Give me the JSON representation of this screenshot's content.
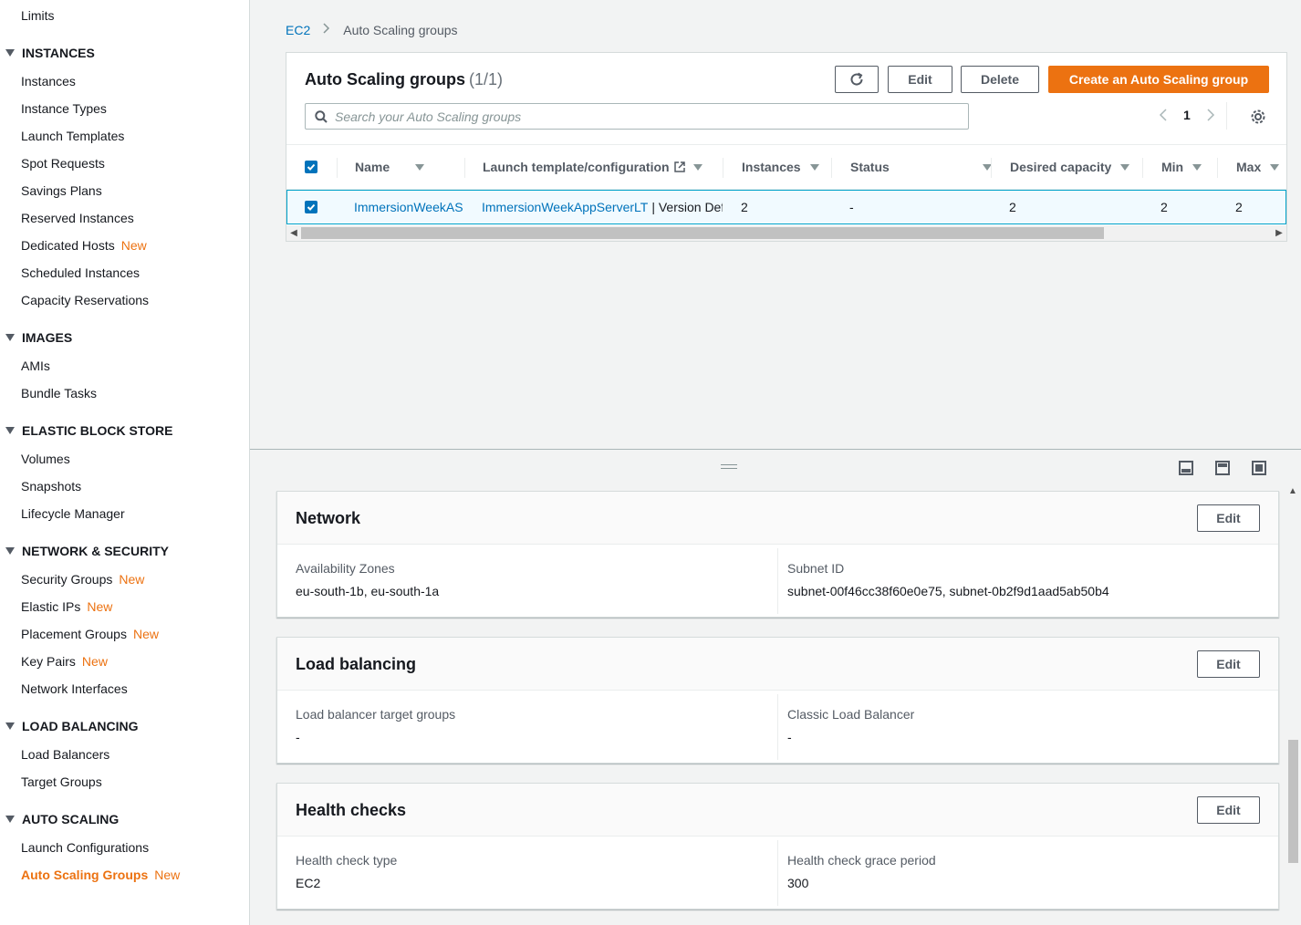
{
  "sidebar": {
    "top_link": "Limits",
    "sections": [
      {
        "title": "INSTANCES",
        "items": [
          {
            "label": "Instances"
          },
          {
            "label": "Instance Types"
          },
          {
            "label": "Launch Templates"
          },
          {
            "label": "Spot Requests"
          },
          {
            "label": "Savings Plans"
          },
          {
            "label": "Reserved Instances"
          },
          {
            "label": "Dedicated Hosts",
            "badge": "New"
          },
          {
            "label": "Scheduled Instances"
          },
          {
            "label": "Capacity Reservations"
          }
        ]
      },
      {
        "title": "IMAGES",
        "items": [
          {
            "label": "AMIs"
          },
          {
            "label": "Bundle Tasks"
          }
        ]
      },
      {
        "title": "ELASTIC BLOCK STORE",
        "items": [
          {
            "label": "Volumes"
          },
          {
            "label": "Snapshots"
          },
          {
            "label": "Lifecycle Manager"
          }
        ]
      },
      {
        "title": "NETWORK & SECURITY",
        "items": [
          {
            "label": "Security Groups",
            "badge": "New"
          },
          {
            "label": "Elastic IPs",
            "badge": "New"
          },
          {
            "label": "Placement Groups",
            "badge": "New"
          },
          {
            "label": "Key Pairs",
            "badge": "New"
          },
          {
            "label": "Network Interfaces"
          }
        ]
      },
      {
        "title": "LOAD BALANCING",
        "items": [
          {
            "label": "Load Balancers"
          },
          {
            "label": "Target Groups"
          }
        ]
      },
      {
        "title": "AUTO SCALING",
        "items": [
          {
            "label": "Launch Configurations"
          },
          {
            "label": "Auto Scaling Groups",
            "badge": "New",
            "active": true
          }
        ]
      }
    ]
  },
  "breadcrumb": {
    "root": "EC2",
    "separator": ">",
    "current": "Auto Scaling groups"
  },
  "asg_panel": {
    "title": "Auto Scaling groups",
    "count": "(1/1)",
    "buttons": {
      "edit": "Edit",
      "delete": "Delete",
      "create": "Create an Auto Scaling group"
    },
    "search_placeholder": "Search your Auto Scaling groups",
    "page": "1",
    "columns": {
      "name": "Name",
      "launch": "Launch template/configuration",
      "instances": "Instances",
      "status": "Status",
      "desired": "Desired capacity",
      "min": "Min",
      "max": "Max"
    },
    "row": {
      "name": "ImmersionWeekAS",
      "launch_link": "ImmersionWeekAppServerLT",
      "launch_suffix": "| Version Def",
      "instances": "2",
      "status": "-",
      "desired": "2",
      "min": "2",
      "max": "2"
    }
  },
  "cards": {
    "network": {
      "title": "Network",
      "edit": "Edit",
      "left_label": "Availability Zones",
      "left_value": "eu-south-1b, eu-south-1a",
      "right_label": "Subnet ID",
      "right_value": "subnet-00f46cc38f60e0e75, subnet-0b2f9d1aad5ab50b4"
    },
    "load_balancing": {
      "title": "Load balancing",
      "edit": "Edit",
      "left_label": "Load balancer target groups",
      "left_value": "-",
      "right_label": "Classic Load Balancer",
      "right_value": "-"
    },
    "health_checks": {
      "title": "Health checks",
      "edit": "Edit",
      "left_label": "Health check type",
      "left_value": "EC2",
      "right_label": "Health check grace period",
      "right_value": "300"
    }
  },
  "colors": {
    "accent": "#ec7211",
    "link": "#0073bb",
    "selected_row": "#f1faff",
    "selected_border": "#00a1c9"
  }
}
